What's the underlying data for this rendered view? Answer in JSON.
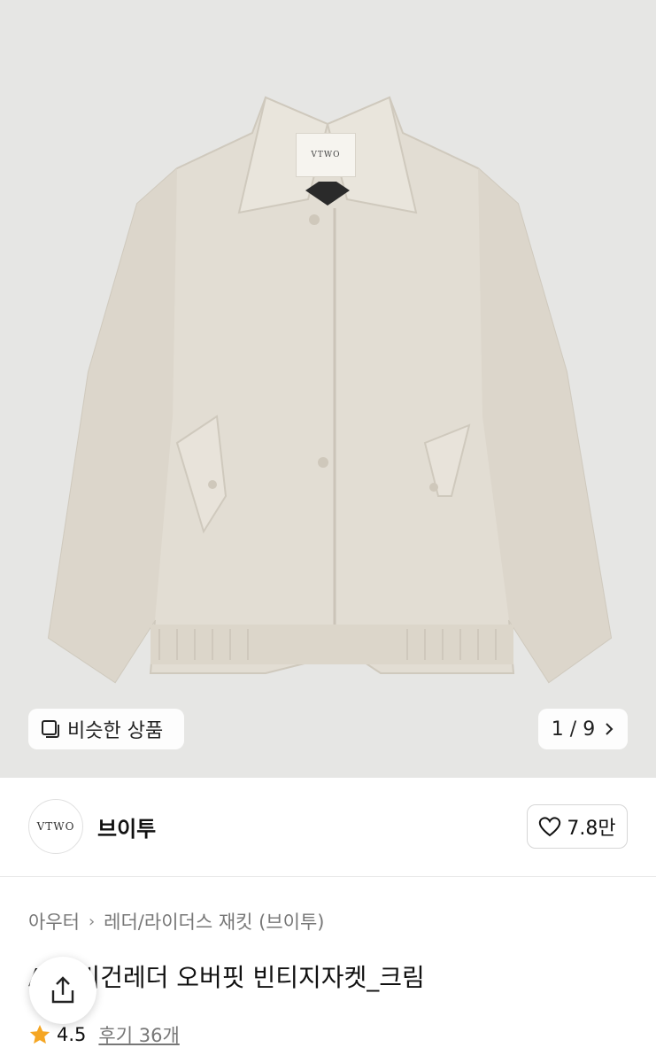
{
  "gallery": {
    "similar_button_label": "비슷한 상품",
    "page_indicator": "1 / 9",
    "tag_text": "VTWO"
  },
  "brand": {
    "logo_text": "VTWO",
    "name": "브이투",
    "like_count": "7.8만"
  },
  "product": {
    "breadcrumb": [
      "아우터",
      "레더/라이더스 재킷 (브이투)"
    ],
    "title": "A-3 비건레더 오버핏 빈티지자켓_크림",
    "rating": "4.5",
    "reviews_label": "후기 36개"
  },
  "colors": {
    "star": "#f5a623",
    "hero_bg": "#e6e6e4",
    "jacket": "#e2ddd3"
  },
  "icons": {
    "similar": "square-stack-icon",
    "chevron": "chevron-right-icon",
    "like": "heart-outline-icon",
    "share": "share-upload-icon",
    "rating": "star-icon"
  }
}
